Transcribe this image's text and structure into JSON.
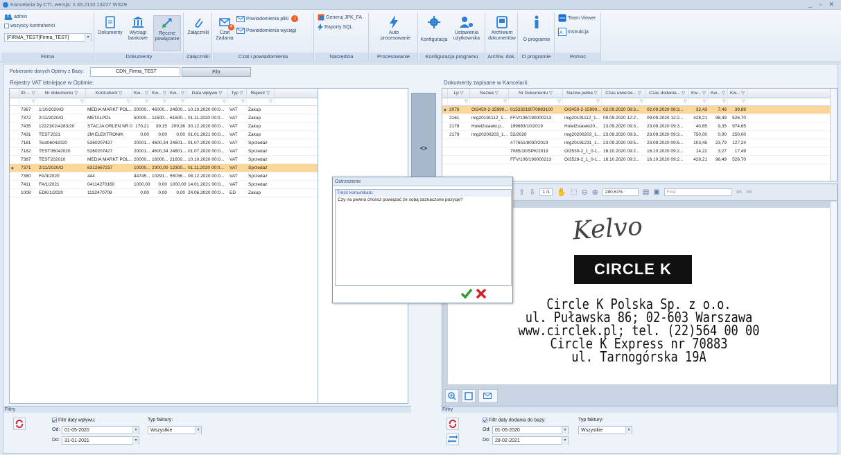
{
  "window": {
    "title": "Kancelaria by CTI, wersja: 2.35.2110.13227 WS29",
    "controls": "_ ▫ ✕"
  },
  "ribbon": {
    "user": {
      "name": "admin",
      "all_contractors": "wszyscy kontrahenci",
      "company": "[FIRMA_TEST]Firma_TEST]",
      "group": "Firma"
    },
    "documents": {
      "btn1": "Dokumenty",
      "btn2": "Wyciągi bankowe",
      "btn3": "Ręczne powiązanie",
      "group": "Dokumenty"
    },
    "attachments": {
      "btn": "Załączniki",
      "group": "Załączniki"
    },
    "chat": {
      "btn1": "Czat",
      "btn2": "Zadania",
      "badge1": "4",
      "notif1": "Powiadomienia pliki",
      "notif2": "Powiadomienia wyciągi",
      "badge2": "1",
      "group": "Czat i powiadomienia"
    },
    "tools": {
      "btn1": "Generuj JPK_FA",
      "btn2": "Raporty SQL",
      "group": "Narzędzia"
    },
    "processing": {
      "btn": "Auto procesowanie",
      "group": "Procesowanie"
    },
    "config": {
      "btn1": "Konfiguracja",
      "btn2": "Ustawienia użytkownika",
      "group": "Konfiguracja programu"
    },
    "archive": {
      "btn": "Archiwum dokumentów",
      "group": "Archiw. dok."
    },
    "about": {
      "btn": "O programie",
      "group": "O programie"
    },
    "help": {
      "btn1": "Team Viewer",
      "btn2": "Instrukcja",
      "group": "Pomoc"
    }
  },
  "left": {
    "source_label": "Pobieranie danych Optimy z Bazy:",
    "source_value": "CDN_Firma_TEST",
    "filter_btn": "Filtr",
    "title": "Rejestry VAT istniejące w Optimie:",
    "columns": [
      "ID ...",
      "Nr dokumentu",
      "Kontrahent",
      "Kw...",
      "Kw...",
      "Kw...",
      "Data wpływu",
      "Typ",
      "Rejestr"
    ],
    "rows": [
      [
        "7367",
        "1/10/2020/O",
        "MEDIA MARKT POL...",
        "20000...",
        "46000...",
        "24600...",
        "10.10.2020 00:0...",
        "VAT",
        "Zakup"
      ],
      [
        "7372",
        "2/11/2020/O",
        "METALPOL",
        "50000...",
        "11500...",
        "61500...",
        "01.11.2020 00:0...",
        "VAT",
        "Zakup"
      ],
      [
        "7435",
        "12221K2/4283/20",
        "STACJA ORLEN NR 05",
        "170,21",
        "39,15",
        "209,36",
        "30.12.2020 00:0...",
        "VAT",
        "Zakup"
      ],
      [
        "7431",
        "TEST2021",
        "2M ELEKTRONIK",
        "0,00",
        "0,00",
        "0,00",
        "01.01.2021 00:0...",
        "VAT",
        "Zakup"
      ],
      [
        "7181",
        "Test06042020",
        "5260207427",
        "20001...",
        "4600,34",
        "24601...",
        "01.07.2020 00:0...",
        "VAT",
        "Sprzedaż"
      ],
      [
        "7182",
        "TEST06042020",
        "5260207427",
        "20001...",
        "4600,34",
        "24601...",
        "01.07.2020 00:0...",
        "VAT",
        "Sprzedaż"
      ],
      [
        "7387",
        "TEST202010",
        "MEDIA MARKT POL...",
        "20000...",
        "16000...",
        "21600...",
        "10.10.2020 00:0...",
        "VAT",
        "Sprzedaż"
      ],
      [
        "7371",
        "2/11/2020/O",
        "6312667237",
        "10000...",
        "2300,00",
        "12300...",
        "01.11.2020 00:0...",
        "VAT",
        "Sprzedaż"
      ],
      [
        "7380",
        "FA/3/2020",
        "444",
        "44745...",
        "10291...",
        "55036...",
        "08.12.2020 00:0...",
        "VAT",
        "Sprzedaż"
      ],
      [
        "7411",
        "FA/1/2021",
        "04114270160",
        "1000,00",
        "0,00",
        "1000,00",
        "14.01.2021 00:0...",
        "VAT",
        "Sprzedaż"
      ],
      [
        "1008",
        "EDK/1/2020",
        "1132470708",
        "0,00",
        "0,00",
        "0,00",
        "24.06.2020 00:0...",
        "ED",
        "Zakup"
      ]
    ],
    "selected_row": 7,
    "filters": {
      "title": "Filtry",
      "date_check": "Filtr daty wpływu:",
      "from_label": "Od:",
      "from": "01-05-2020",
      "to_label": "Do:",
      "to": "31-01-2021",
      "type_label": "Typ faktury:",
      "type": "Wszystkie"
    }
  },
  "mid": {
    "arrow": "<>"
  },
  "right": {
    "title": "Dokumenty zapisane w Kancelarii:",
    "columns": [
      "Lp",
      "Nazwa",
      "Nr Dokumentu",
      "Nazwa pełna",
      "Czas utworze...",
      "Czas dodania...",
      "Kw...",
      "Kw...",
      "Kw..."
    ],
    "rows": [
      [
        "2078",
        "OI3450-2-15990...",
        "01533219070883100",
        "OI3450-2-15990...",
        "02.09.2020 08:3...",
        "02.09.2020 08:3...",
        "32,43",
        "7,46",
        "39,89"
      ],
      [
        "2161",
        "img20191112_1...",
        "FFV/106/190000213",
        "img20191112_1...",
        "09.09.2020 12:2...",
        "09.09.2020 12:2...",
        "428,21",
        "98,49",
        "526,70"
      ],
      [
        "2178",
        "Hotel2stawki.p...",
        "199683/10/2019",
        "Hotel2stawki20...",
        "23.09.2020 09:3...",
        "23.09.2020 09:3...",
        "40,65",
        "9,35",
        "974,65"
      ],
      [
        "2179",
        "img20200203_1...",
        "52/2020",
        "img20200203_1...",
        "23.09.2020 09:3...",
        "23.09.2020 09:3...",
        "750,00",
        "0,00",
        "250,00"
      ],
      [
        "",
        "",
        "#77651/8030/2019",
        "img20191231_1...",
        "23.09.2020 09:5...",
        "23.09.2020 09:5...",
        "103,45",
        "23,79",
        "127,24"
      ],
      [
        "",
        "",
        "7085/10/SPK/2019",
        "OI3530-2_1_0-1...",
        "16.10.2020 09:2...",
        "16.10.2020 09:2...",
        "14,22",
        "3,27",
        "17,49"
      ],
      [
        "",
        "",
        "FFV/106/190000213",
        "OI3528-2_1_0-1...",
        "16.10.2020 09:2...",
        "16.10.2020 09:2...",
        "428,21",
        "98,49",
        "526,70"
      ]
    ],
    "selected_row": 0,
    "viewer": {
      "page": "1 /1",
      "zoom": "280,61%",
      "find": "Find"
    },
    "receipt": {
      "signature": "Kelvo",
      "logo": "CIRCLE K",
      "line1": "Circle K Polska Sp. z o.o.",
      "line2": "ul. Puławska 86; 02-603 Warszawa",
      "line3": "www.circlek.pl; tel. (22)564 00 00",
      "line4": "Circle K Express nr 70883",
      "line5": "ul. Tarnogórska 19A"
    },
    "filters": {
      "title": "Filtry",
      "date_check": "Filtr daty dodania do bazy:",
      "from_label": "Od:",
      "from": "01-05-2020",
      "to_label": "Do:",
      "to": "28-02-2021",
      "type_label": "Typ faktury:",
      "type": "Wszystkie"
    }
  },
  "dialog": {
    "title": "Ostrzeżenie",
    "header": "Treść komunikatu:",
    "message": "Czy na pewno chcesz powiązać ze sobą zaznaczone pozycje?"
  },
  "colors": {
    "selected_row": "#fdd69a",
    "accent": "#2d7fd3",
    "danger": "#d4202a",
    "ok": "#2aa12e"
  }
}
